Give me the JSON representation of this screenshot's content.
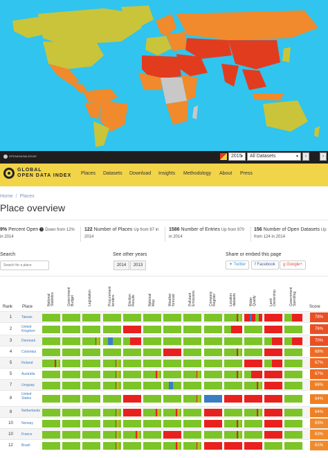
{
  "map": {
    "attribution": "OPENKNOWLEDGE",
    "year": "2015",
    "dataset": "All Datasets",
    "prev_btn": "‹",
    "next_btn": "›",
    "colors": {
      "ocean": "#30c4ee",
      "high": "#e23c1e",
      "mid": "#f08a2c",
      "low": "#c9c43a",
      "none": "#c8c8c8"
    }
  },
  "header": {
    "logo_line1": "GLOBAL",
    "logo_line2": "OPEN DATA INDEX",
    "nav": [
      "Places",
      "Datasets",
      "Download",
      "Insights",
      "Methodology",
      "About",
      "Press"
    ],
    "color": "#f2d449"
  },
  "breadcrumb": [
    "Home",
    "Places"
  ],
  "page_title": "Place overview",
  "stats": [
    {
      "value": "9%",
      "label": "Percent Open",
      "note": "Down from 12%",
      "note2": "in 2014"
    },
    {
      "value": "122",
      "label": "Number of Places",
      "note": "Up from 97 in",
      "note2": "2014"
    },
    {
      "value": "1586",
      "label": "Number of Entries",
      "note": "Up from 970",
      "note2": "in 2014"
    },
    {
      "value": "156",
      "label": "Number of Open Datasets",
      "note": "Up",
      "note2": "from 124 in 2014"
    }
  ],
  "search": {
    "label": "Search",
    "placeholder": "Search for a place"
  },
  "other_years": {
    "label": "See other years",
    "years": [
      "2014",
      "2013"
    ]
  },
  "share": {
    "label": "Share or embed this page",
    "twitter": "Twitter",
    "facebook": "Facebook",
    "google": "Google+"
  },
  "table": {
    "rank_header": "Rank",
    "place_header": "Place",
    "score_header": "Score",
    "columns": [
      [
        "National",
        "Statistics"
      ],
      [
        "Government",
        "Budget"
      ],
      [
        "Legislation"
      ],
      [
        "Procurement",
        "tenders"
      ],
      [
        "Election",
        "Results"
      ],
      [
        "National",
        "Map"
      ],
      [
        "Weather",
        "forecast"
      ],
      [
        "Pollutant",
        "Emissions"
      ],
      [
        "Company",
        "Register"
      ],
      [
        "Location",
        "datasets"
      ],
      [
        "Water",
        "Quality"
      ],
      [
        "Land",
        "Ownership"
      ],
      [
        "Government",
        "Spending"
      ]
    ],
    "rows": [
      {
        "rank": "1",
        "place": "Taiwan",
        "score": "78%",
        "cells": [
          "G",
          "G",
          "G",
          "G",
          "G",
          "G",
          "G",
          "G",
          "G",
          "GM",
          "RB",
          "R",
          "GR"
        ]
      },
      {
        "rank": "2",
        "place": "United Kingdom",
        "score": "76%",
        "cells": [
          "G",
          "G",
          "G",
          "G",
          "R",
          "G",
          "G",
          "G",
          "G",
          "GR",
          "G",
          "R",
          "G"
        ]
      },
      {
        "rank": "3",
        "place": "Denmark",
        "score": "70%",
        "cells": [
          "G",
          "G",
          "GM",
          "BM",
          "GR",
          "G",
          "G",
          "G",
          "G",
          "G",
          "G",
          "GR",
          "GR"
        ]
      },
      {
        "rank": "4",
        "place": "Colombia",
        "score": "68%",
        "cells": [
          "G",
          "G",
          "G",
          "G",
          "G",
          "G",
          "R",
          "G",
          "G",
          "GM",
          "G",
          "R",
          "G"
        ]
      },
      {
        "rank": "5",
        "place": "Finland",
        "score": "67%",
        "cells": [
          "GM",
          "G",
          "G",
          "GM",
          "G",
          "G",
          "G",
          "G",
          "G",
          "G",
          "R",
          "GR",
          "G"
        ]
      },
      {
        "rank": "5",
        "place": "Australia",
        "score": "67%",
        "cells": [
          "G",
          "G",
          "G",
          "GM",
          "G",
          "GM",
          "G",
          "GM",
          "G",
          "GM",
          "GR",
          "R",
          "G"
        ]
      },
      {
        "rank": "7",
        "place": "Uruguay",
        "score": "66%",
        "cells": [
          "G",
          "G",
          "G",
          "GM",
          "G",
          "G",
          "BM",
          "G",
          "G",
          "G",
          "GM",
          "R",
          "G"
        ]
      },
      {
        "rank": "8",
        "place": "United States",
        "score": "64%",
        "cells": [
          "G",
          "G",
          "G",
          "G",
          "R",
          "G",
          "G",
          "GM",
          "B",
          "R",
          "R",
          "R",
          "G"
        ]
      },
      {
        "rank": "8",
        "place": "Netherlands",
        "score": "64%",
        "cells": [
          "G",
          "G",
          "G",
          "GM",
          "R",
          "GM",
          "GM",
          "G",
          "R",
          "G",
          "GM",
          "R",
          "G"
        ]
      },
      {
        "rank": "10",
        "place": "Norway",
        "score": "63%",
        "cells": [
          "G",
          "G",
          "G",
          "GM",
          "G",
          "G",
          "G",
          "G",
          "R",
          "GM",
          "G",
          "R",
          "G"
        ]
      },
      {
        "rank": "10",
        "place": "France",
        "score": "63%",
        "cells": [
          "G",
          "G",
          "G",
          "GM",
          "GM",
          "G",
          "R",
          "G",
          "G",
          "GM",
          "G",
          "R",
          "G"
        ]
      },
      {
        "rank": "12",
        "place": "Brazil",
        "score": "61%",
        "cells": [
          "G",
          "G",
          "G",
          "GM",
          "G",
          "G",
          "GM",
          "GM",
          "R",
          "R",
          "R",
          "G",
          "G"
        ]
      }
    ],
    "palette": {
      "G": "#7cc427",
      "R": "#e9211e",
      "B": "#3a7dc4",
      "Y": "#f2c400"
    },
    "score_colors": [
      "#e94f25",
      "#ef6a22",
      "#f07f22",
      "#f08a2c"
    ]
  }
}
